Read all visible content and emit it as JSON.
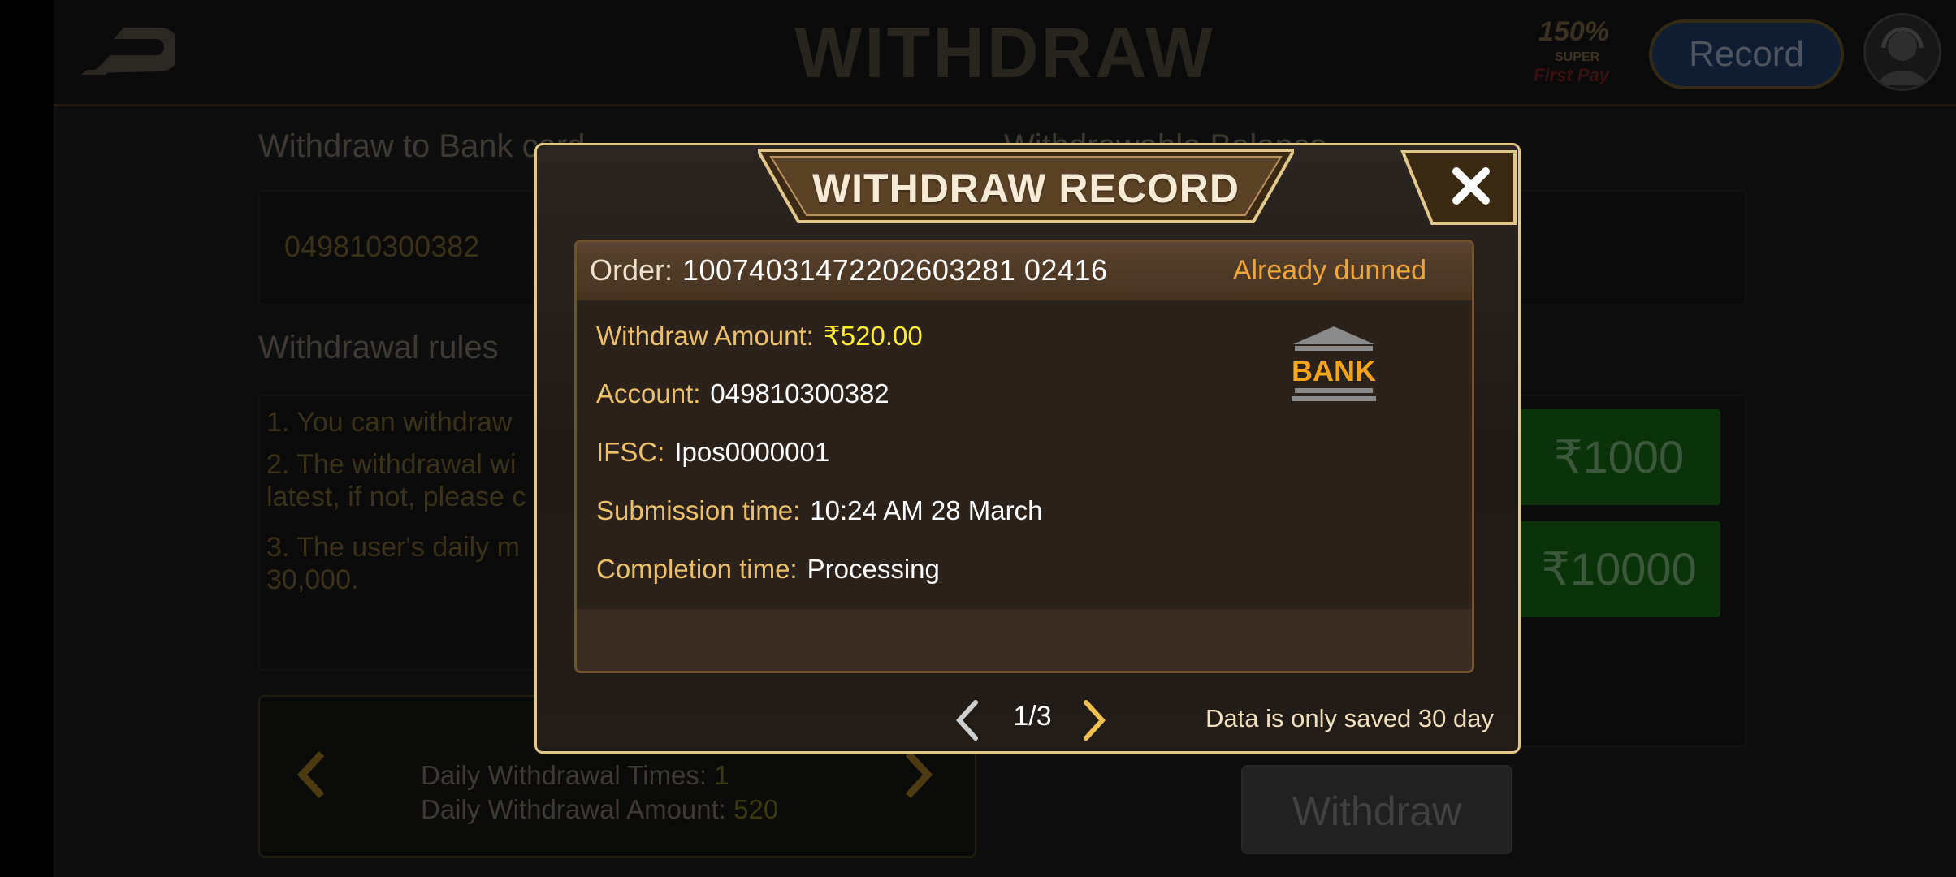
{
  "header": {
    "title": "WITHDRAW",
    "promo": {
      "percent": "150%",
      "super": "SUPER",
      "first_pay": "First Pay"
    },
    "record_label": "Record"
  },
  "background": {
    "withdraw_to_label": "Withdraw to Bank card",
    "balance_label": "Withdrawable Balance",
    "account_value": "049810300382",
    "rules_title": "Withdrawal rules",
    "rules": [
      "1. You can withdraw",
      "2. The withdrawal wi",
      "latest, if not, please c",
      "3. The user's daily m",
      "30,000."
    ],
    "quick_amounts": [
      "₹1000",
      "₹10000"
    ],
    "stats": {
      "times_label": "Daily Withdrawal Times: ",
      "times_value": "1",
      "amount_label": "Daily Withdrawal Amount: ",
      "amount_value": "520"
    },
    "withdraw_button": "Withdraw"
  },
  "dialog": {
    "title": "WITHDRAW RECORD",
    "record": {
      "order_label": "Order:",
      "order_no": "10074031472202603281 02416",
      "status": "Already dunned",
      "amount_label": "Withdraw Amount:",
      "amount": "₹520.00",
      "account_label": "Account:",
      "account": "049810300382",
      "ifsc_label": "IFSC:",
      "ifsc": "Ipos0000001",
      "submission_label": "Submission time:",
      "submission": "10:24 AM 28 March",
      "completion_label": "Completion time:",
      "completion": "Processing",
      "bank_text": "BANK"
    },
    "pager": {
      "current": "1/3"
    },
    "footnote": "Data is only saved 30 day"
  },
  "colors": {
    "gold": "#e0c88a",
    "status_orange": "#f0a53a",
    "amount_yellow": "#ffec2a",
    "label_gold": "#ecc06a"
  }
}
